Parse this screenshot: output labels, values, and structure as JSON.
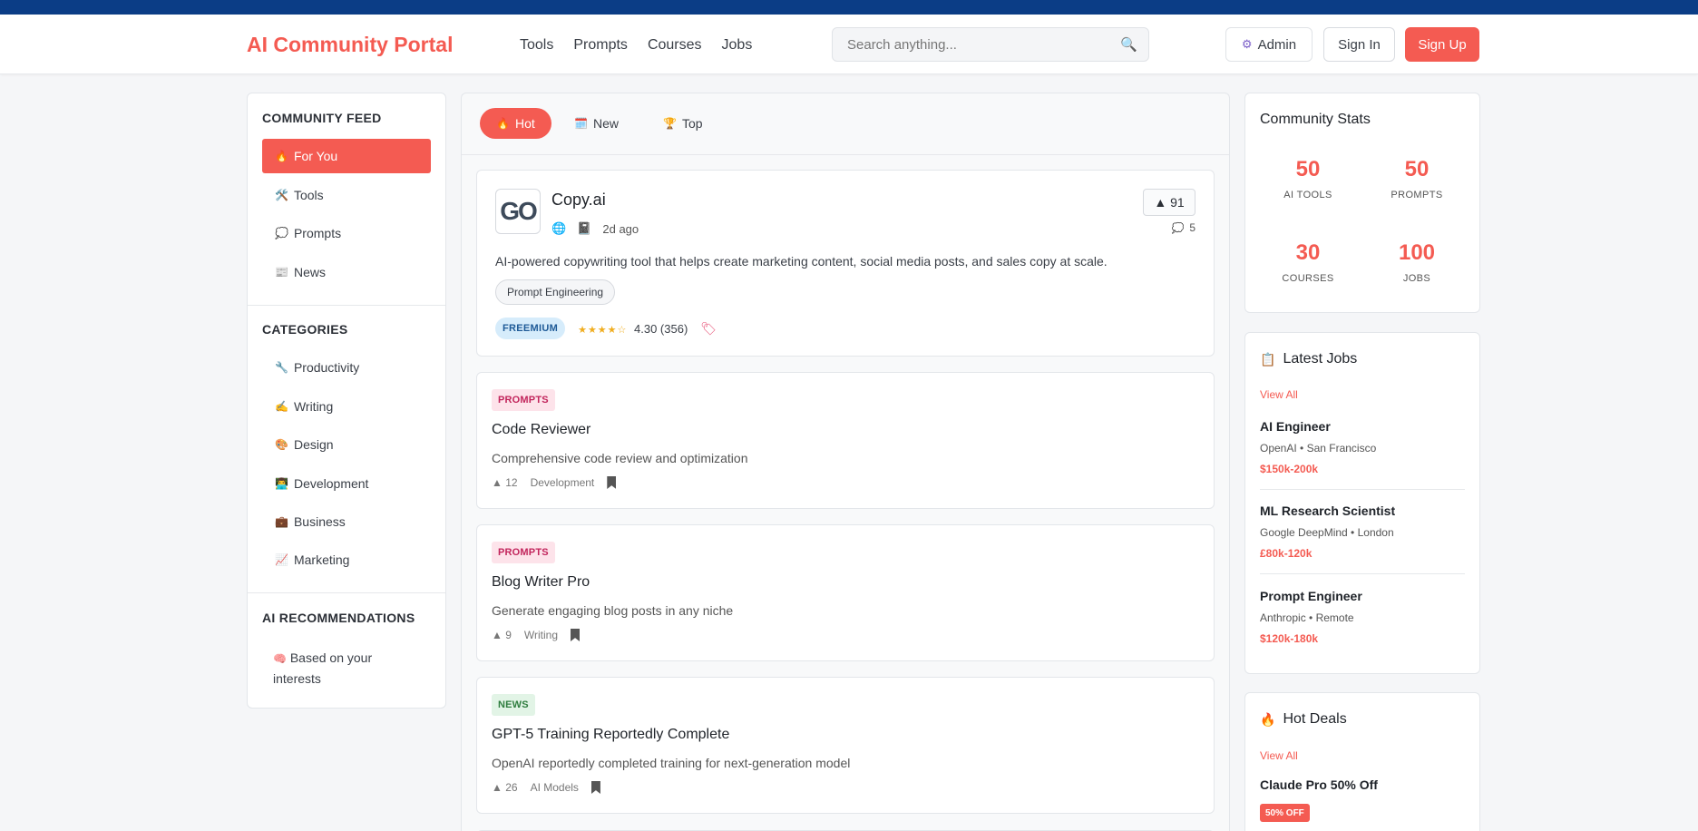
{
  "header": {
    "brand": "AI Community Portal",
    "nav": [
      "Tools",
      "Prompts",
      "Courses",
      "Jobs"
    ],
    "search_placeholder": "Search anything...",
    "admin_label": "Admin",
    "signin_label": "Sign In",
    "signup_label": "Sign Up"
  },
  "sidebar": {
    "feed_title": "COMMUNITY FEED",
    "feed_items": [
      {
        "icon": "🔥",
        "label": "For You"
      },
      {
        "icon": "🛠️",
        "label": "Tools"
      },
      {
        "icon": "💭",
        "label": "Prompts"
      },
      {
        "icon": "📰",
        "label": "News"
      }
    ],
    "categories_title": "CATEGORIES",
    "categories": [
      {
        "icon": "🔧",
        "label": "Productivity"
      },
      {
        "icon": "✍️",
        "label": "Writing"
      },
      {
        "icon": "🎨",
        "label": "Design"
      },
      {
        "icon": "👨‍💻",
        "label": "Development"
      },
      {
        "icon": "💼",
        "label": "Business"
      },
      {
        "icon": "📈",
        "label": "Marketing"
      }
    ],
    "reco_title": "AI RECOMMENDATIONS",
    "reco_icon": "🧠",
    "reco_text_1": "Based on your",
    "reco_text_2": "interests"
  },
  "feed": {
    "tabs": [
      {
        "icon": "🔥",
        "label": "Hot"
      },
      {
        "icon": "🗓️",
        "label": "New"
      },
      {
        "icon": "🏆",
        "label": "Top"
      }
    ],
    "tool_card": {
      "logo_text": "GO",
      "name": "Copy.ai",
      "globe_icon": "🌐",
      "book_icon": "📓",
      "time": "2d ago",
      "votes": "▲ 91",
      "comment_icon": "💭",
      "comments": "5",
      "description": "AI-powered copywriting tool that helps create marketing content, social media posts, and sales copy at scale.",
      "tag": "Prompt Engineering",
      "pricing": "FREEMIUM",
      "stars": "★★★★☆",
      "rating": "4.30 (356)",
      "coupon_icon": "🏷"
    },
    "posts": [
      {
        "badge": "PROMPTS",
        "title": "Code Reviewer",
        "desc": "Comprehensive code review and optimization",
        "votes": "▲ 12",
        "category": "Development"
      },
      {
        "badge": "PROMPTS",
        "title": "Blog Writer Pro",
        "desc": "Generate engaging blog posts in any niche",
        "votes": "▲ 9",
        "category": "Writing"
      },
      {
        "badge": "NEWS",
        "title": "GPT-5 Training Reportedly Complete",
        "desc": "OpenAI reportedly completed training for next-generation model",
        "votes": "▲ 26",
        "category": "AI Models"
      }
    ]
  },
  "stats": {
    "title": "Community Stats",
    "items": [
      {
        "num": "50",
        "label": "AI TOOLS"
      },
      {
        "num": "50",
        "label": "PROMPTS"
      },
      {
        "num": "30",
        "label": "COURSES"
      },
      {
        "num": "100",
        "label": "JOBS"
      }
    ]
  },
  "jobs": {
    "icon": "📋",
    "title": "Latest Jobs",
    "view_all": "View All",
    "items": [
      {
        "title": "AI Engineer",
        "company": "OpenAI • San Francisco",
        "salary": "$150k-200k"
      },
      {
        "title": "ML Research Scientist",
        "company": "Google DeepMind • London",
        "salary": "£80k-120k"
      },
      {
        "title": "Prompt Engineer",
        "company": "Anthropic • Remote",
        "salary": "$120k-180k"
      }
    ]
  },
  "deals": {
    "icon": "🔥",
    "title": "Hot Deals",
    "view_all": "View All",
    "deal_title": "Claude Pro 50% Off",
    "deal_badge": "50% OFF"
  },
  "colors": {
    "accent": "#f45b52",
    "topbar": "#0b3d86"
  }
}
